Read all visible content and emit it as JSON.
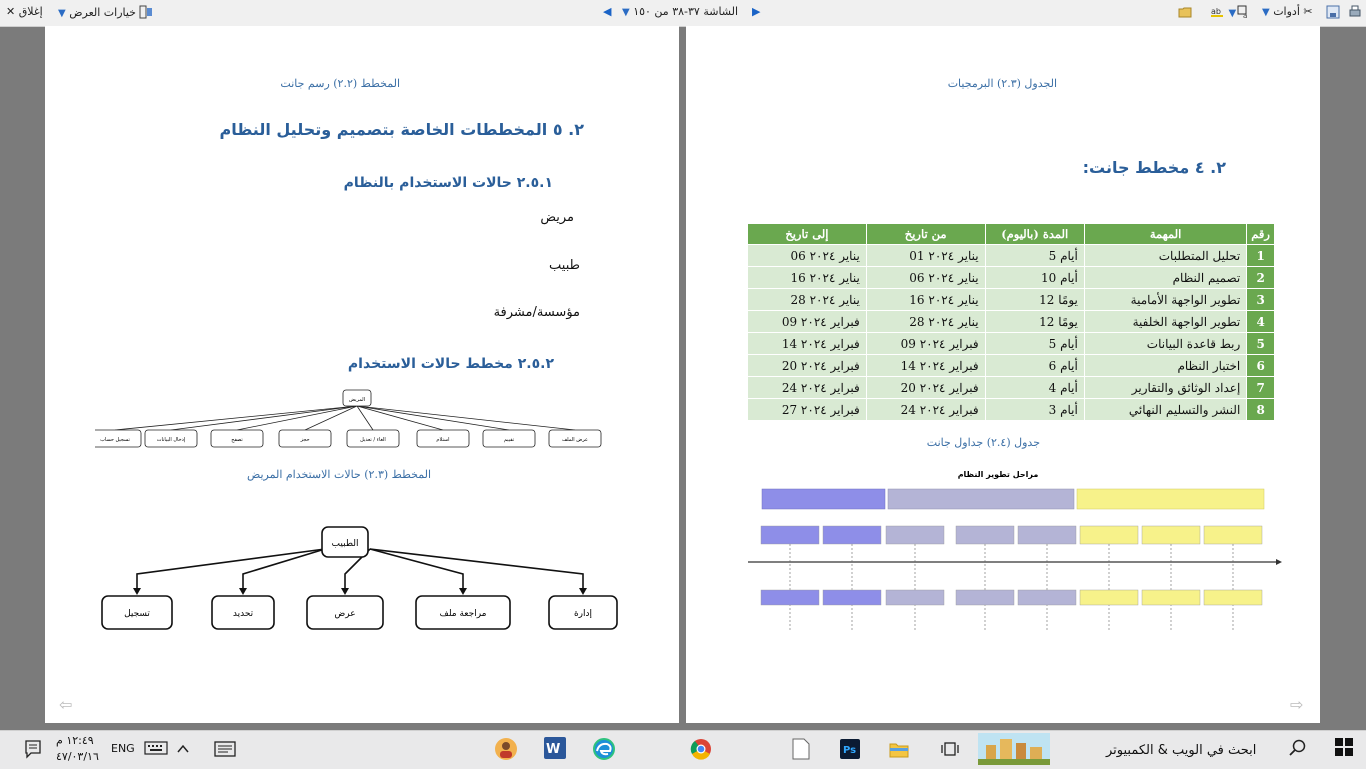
{
  "toolbar": {
    "close": "إغلاق",
    "view_options": "خيارات العرض",
    "screen_indicator": "الشاشة ٣٧-٣٨ من ١٥٠",
    "tools": "أدوات"
  },
  "left_page": {
    "caption_top": "المخطط (٢.٢) رسم جانت",
    "heading_main": "٢. ٥ المخططات الخاصة بتصميم وتحليل النظام",
    "heading_usecases": "٢.٥.١ حالات الاستخدام بالنظام",
    "actor1": "مريض",
    "actor2": "طبيب",
    "actor3": "مؤسسة/مشرفة",
    "heading_usecase_diagram": "٢.٥.٢ مخطط حالات الاستخدام",
    "patient_diagram": {
      "root": "المريض",
      "children": [
        "عرض الملف",
        "تقييم",
        "استلام",
        "الغاء / تعديل",
        "حجز",
        "تصفح",
        "إدخال البيانات",
        "تسجيل حساب"
      ]
    },
    "caption_patient": "المخطط (٢.٣) حالات الاستخدام المريض",
    "doctor_diagram": {
      "root": "الطبيب",
      "children": [
        "إدارة",
        "مراجعة ملف",
        "عرض",
        "تحديد",
        "تسجيل"
      ]
    }
  },
  "right_page": {
    "caption_top": "الجدول (٢.٣) البرمجيات",
    "heading_gantt": "٢. ٤ مخطط جانت:",
    "table": {
      "headers": [
        "رقم",
        "المهمة",
        "المدة (باليوم)",
        "من تاريخ",
        "إلى تاريخ"
      ],
      "rows": [
        [
          "1",
          "تحليل المتطلبات",
          "أيام 5",
          "يناير ٢٠٢٤ 01",
          "يناير ٢٠٢٤ 06"
        ],
        [
          "2",
          "تصميم النظام",
          "أيام 10",
          "يناير ٢٠٢٤ 06",
          "يناير ٢٠٢٤ 16"
        ],
        [
          "3",
          "تطوير الواجهة الأمامية",
          "يومًا 12",
          "يناير ٢٠٢٤ 16",
          "يناير ٢٠٢٤ 28"
        ],
        [
          "4",
          "تطوير الواجهة الخلفية",
          "يومًا 12",
          "يناير ٢٠٢٤ 28",
          "فبراير ٢٠٢٤ 09"
        ],
        [
          "5",
          "ربط قاعدة البيانات",
          "أيام 5",
          "فبراير ٢٠٢٤ 09",
          "فبراير ٢٠٢٤ 14"
        ],
        [
          "6",
          "اختبار النظام",
          "أيام 6",
          "فبراير ٢٠٢٤ 14",
          "فبراير ٢٠٢٤ 20"
        ],
        [
          "7",
          "إعداد الوثائق والتقارير",
          "أيام 4",
          "فبراير ٢٠٢٤ 20",
          "فبراير ٢٠٢٤ 24"
        ],
        [
          "8",
          "النشر والتسليم النهائي",
          "أيام 3",
          "فبراير ٢٠٢٤ 24",
          "فبراير ٢٠٢٤ 27"
        ]
      ]
    },
    "caption_table": "جدول (٢.٤) جداول جانت",
    "timeline_title": "مراحل تطوير النظام"
  },
  "taskbar": {
    "search_placeholder": "ابحث في الويب & الكمبيوتر",
    "lang": "ENG",
    "time": "١٢:٤٩ م",
    "date": "٤٧/٠٣/١٦"
  },
  "colors": {
    "table_header": "#6aa84f",
    "table_cell": "#d9ead3",
    "heading_blue": "#2a5e99",
    "timeline_phase1": "#8e8ee8",
    "timeline_phase2": "#b4b4d6",
    "timeline_phase3": "#f7f28a"
  }
}
